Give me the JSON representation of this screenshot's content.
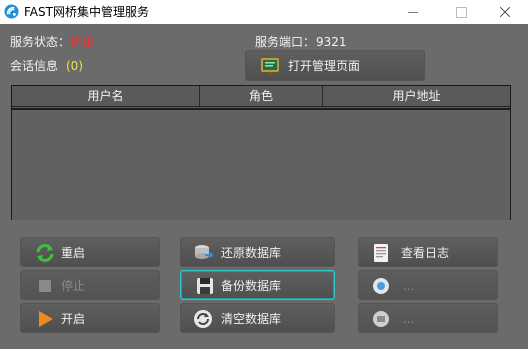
{
  "window": {
    "title": "FAST网桥集中管理服务"
  },
  "status": {
    "service_label": "服务状态：",
    "service_value": "停止",
    "session_label": "会话信息",
    "session_value": "(0)",
    "port_label": "服务端口：",
    "port_value": "9321"
  },
  "buttons": {
    "open_admin": "打开管理页面",
    "restart": "重启",
    "stop": "停止",
    "start": "开启",
    "restore_db": "还原数据库",
    "backup_db": "备份数据库",
    "clear_db": "清空数据库",
    "view_log": "查看日志",
    "hidden_1": "...",
    "hidden_2": "..."
  },
  "table": {
    "columns": [
      "用户名",
      "角色",
      "用户地址"
    ]
  },
  "colors": {
    "stopped": "#ff2a2a",
    "session_count": "#f0e24a",
    "focus_border": "#2ec6c6"
  }
}
